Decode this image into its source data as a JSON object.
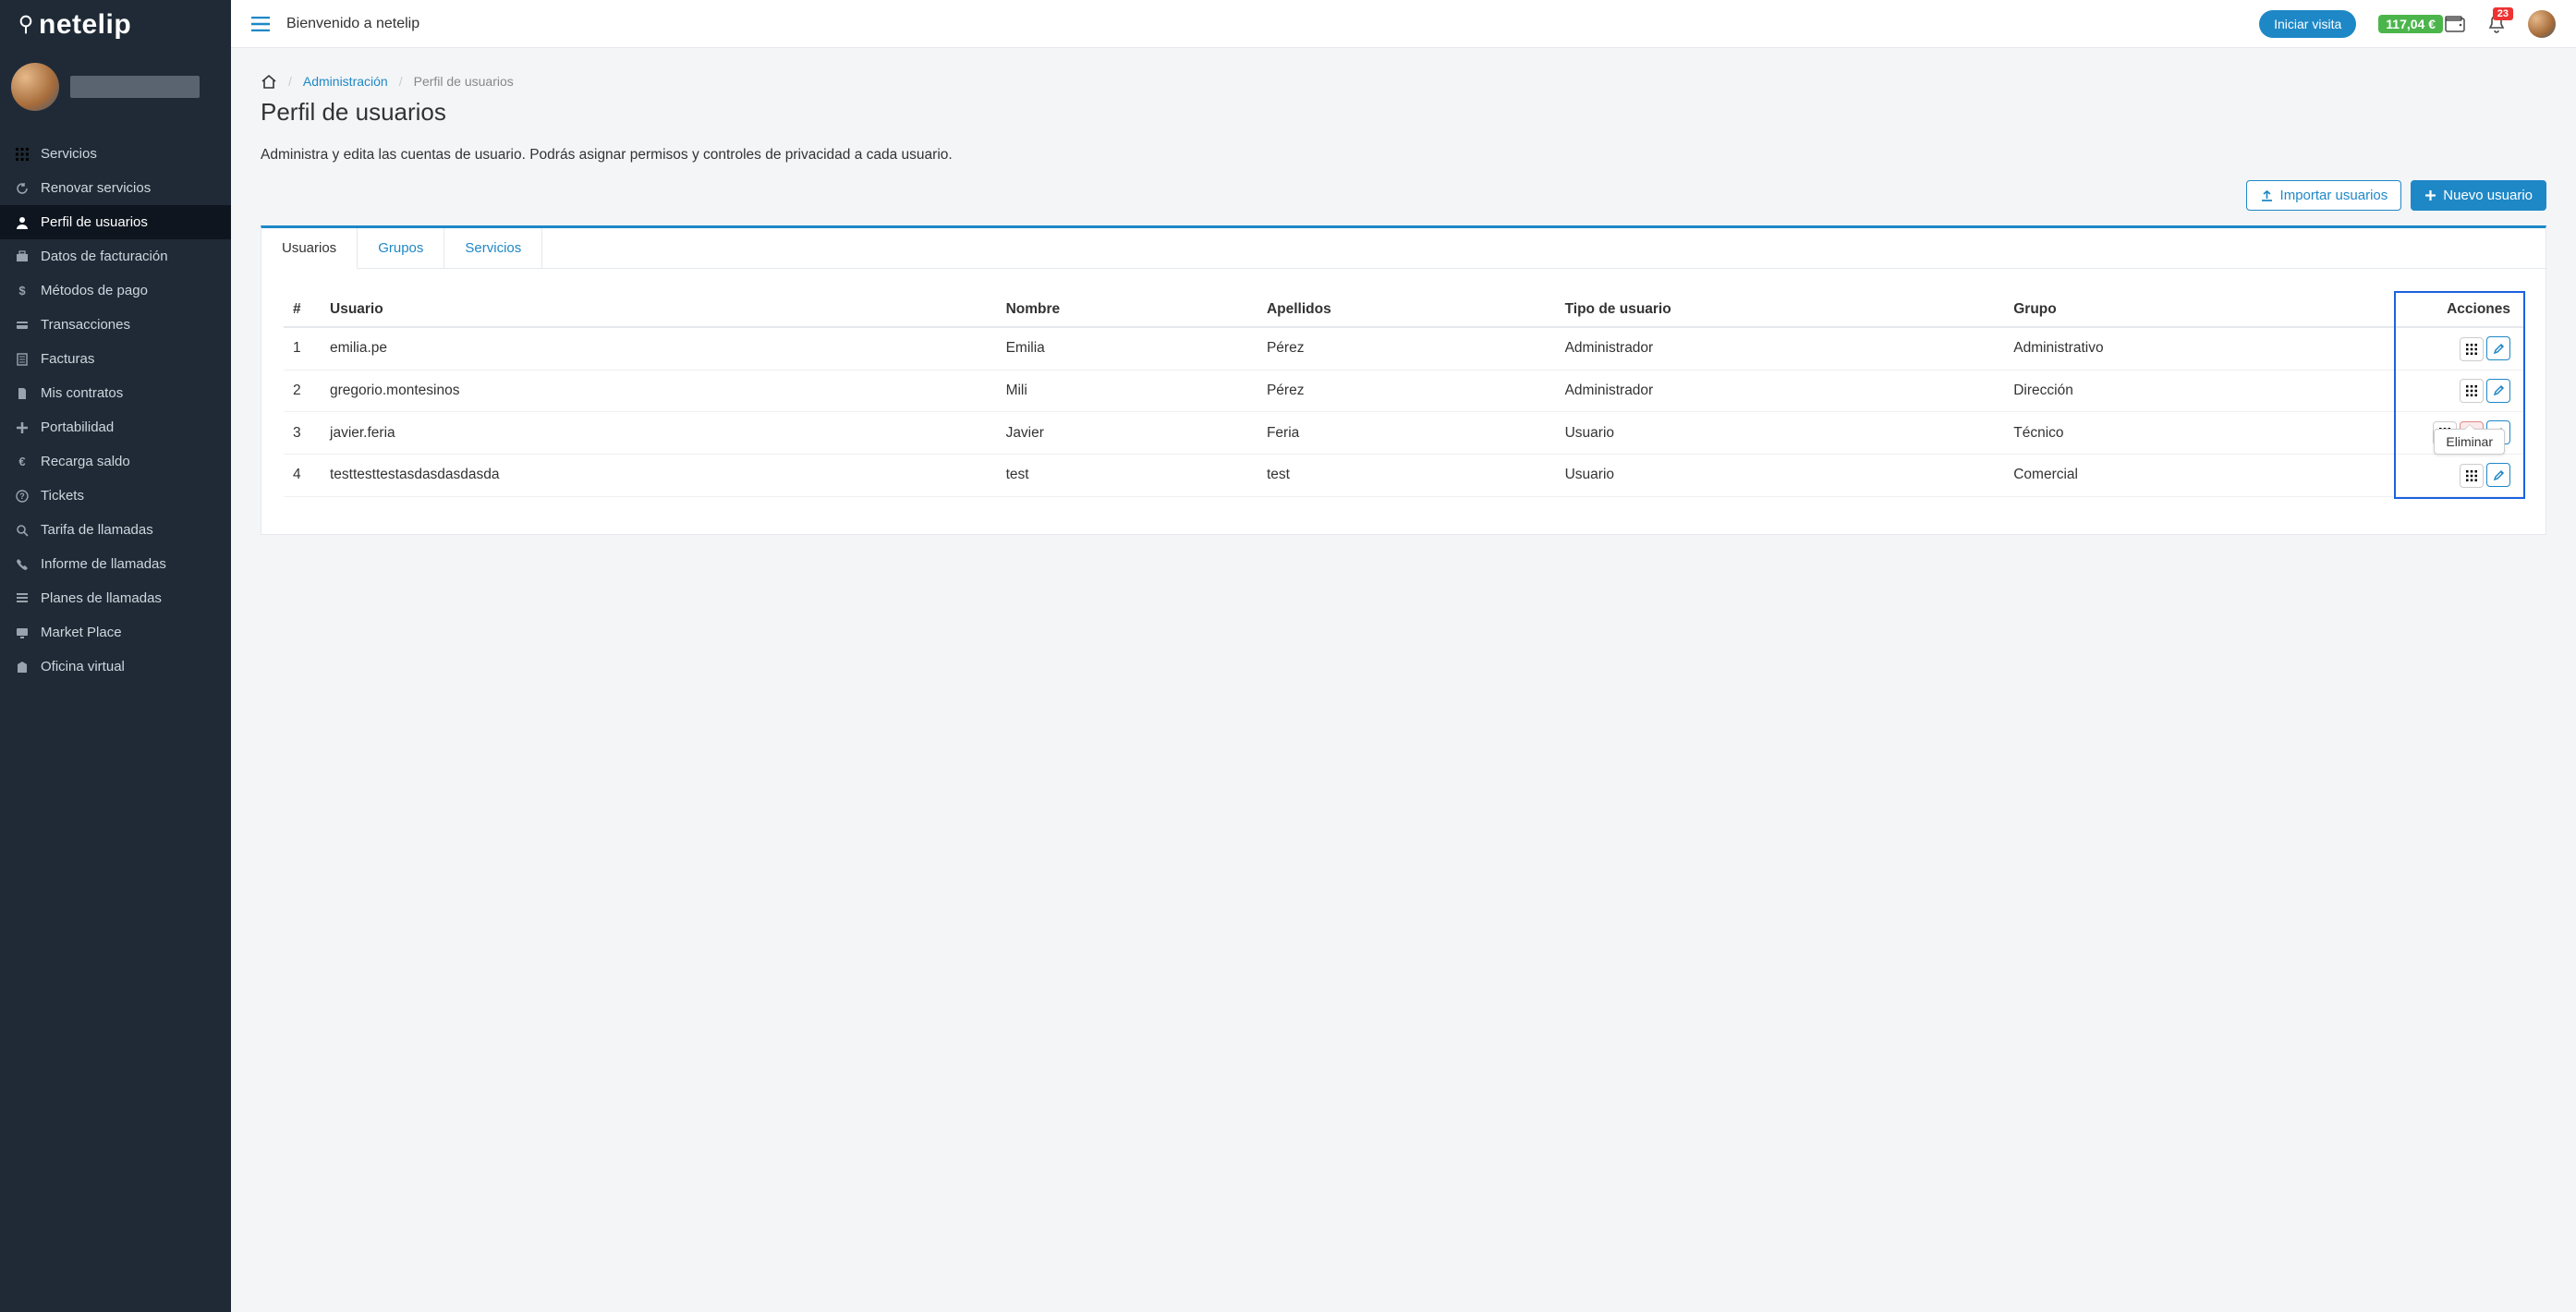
{
  "brand": "netelip",
  "header": {
    "welcome": "Bienvenido a netelip",
    "visit_button": "Iniciar visita",
    "balance": "117,04 €",
    "notifications": "23"
  },
  "sidebar": {
    "items": [
      {
        "icon": "grid",
        "label": "Servicios"
      },
      {
        "icon": "refresh",
        "label": "Renovar servicios"
      },
      {
        "icon": "user",
        "label": "Perfil de usuarios",
        "active": true
      },
      {
        "icon": "briefcase",
        "label": "Datos de facturación"
      },
      {
        "icon": "dollar",
        "label": "Métodos de pago"
      },
      {
        "icon": "card",
        "label": "Transacciones"
      },
      {
        "icon": "file",
        "label": "Facturas"
      },
      {
        "icon": "doc",
        "label": "Mis contratos"
      },
      {
        "icon": "plus",
        "label": "Portabilidad"
      },
      {
        "icon": "euro",
        "label": "Recarga saldo"
      },
      {
        "icon": "help",
        "label": "Tickets"
      },
      {
        "icon": "search",
        "label": "Tarifa de llamadas"
      },
      {
        "icon": "phone",
        "label": "Informe de llamadas"
      },
      {
        "icon": "plan",
        "label": "Planes de llamadas"
      },
      {
        "icon": "monitor",
        "label": "Market Place"
      },
      {
        "icon": "office",
        "label": "Oficina virtual"
      }
    ]
  },
  "breadcrumb": {
    "admin": "Administración",
    "current": "Perfil de usuarios"
  },
  "page": {
    "title": "Perfil de usuarios",
    "description": "Administra y edita las cuentas de usuario. Podrás asignar permisos y controles de privacidad a cada usuario.",
    "import_button": "Importar usuarios",
    "new_button": "Nuevo usuario"
  },
  "tabs": {
    "users": "Usuarios",
    "groups": "Grupos",
    "services": "Servicios"
  },
  "table": {
    "headers": {
      "num": "#",
      "user": "Usuario",
      "name": "Nombre",
      "surname": "Apellidos",
      "type": "Tipo de usuario",
      "group": "Grupo",
      "actions": "Acciones"
    },
    "rows": [
      {
        "num": "1",
        "user": "emilia.pe",
        "name": "Emilia",
        "surname": "Pérez",
        "type": "Administrador",
        "group": "Administrativo",
        "deletable": false
      },
      {
        "num": "2",
        "user": "gregorio.montesinos",
        "name": "Mili",
        "surname": "Pérez",
        "type": "Administrador",
        "group": "Dirección",
        "deletable": false
      },
      {
        "num": "3",
        "user": "javier.feria",
        "name": "Javier",
        "surname": "Feria",
        "type": "Usuario",
        "group": "Técnico",
        "deletable": true
      },
      {
        "num": "4",
        "user": "testtesttestasdasdasdasda",
        "name": "test",
        "surname": "test",
        "type": "Usuario",
        "group": "Comercial",
        "deletable": false
      }
    ]
  },
  "tooltip": "Eliminar"
}
